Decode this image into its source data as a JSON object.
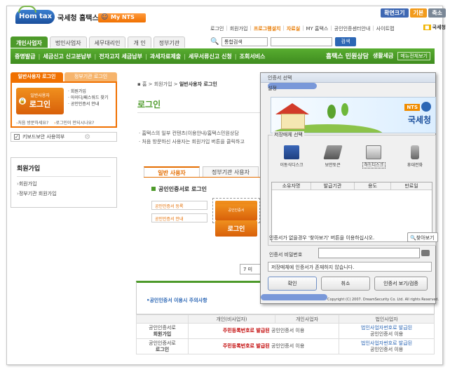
{
  "header": {
    "logo_text": "Hom tax",
    "site_name": "국세청 홈택스",
    "mynts_label": "My NTS",
    "top_buttons": [
      "확면크기",
      "기본",
      "축소"
    ],
    "top_links": [
      "로그인",
      "회원가입",
      "프로그램설치",
      "자료실",
      "MY 홈택스",
      "공인인증센터안내",
      "사이트맵"
    ],
    "kukse_label": "국세청"
  },
  "tabs": [
    "개인사업자",
    "법인사업자",
    "세무대리인",
    "개 인",
    "정부기관"
  ],
  "search": {
    "select_value": "통합검색",
    "button_label": "검색"
  },
  "green_nav": {
    "items": [
      "증명발급",
      "세금신고 신고분납부",
      "전자고지 세금납부",
      "과세자료제출",
      "세무서류신고 신청",
      "조회서비스"
    ],
    "minwon": "홈택스 민원상담",
    "life": "생활세금",
    "all_service": "메뉴전체보기"
  },
  "left": {
    "tab_general": "일반사용자 로그인",
    "tab_gov": "정부기관 로그인",
    "login_small": "일반사용자",
    "login_big": "로그인",
    "menu": [
      "· 회원가입",
      "· 아이디/패스워드 찾기",
      "· 공인인증서 안내"
    ],
    "first_visit": "처음 방문하세요?",
    "safe_login": "로그인이 안되시나요?",
    "keyboard_label": "키보드보안 사용여부",
    "join_title": "회원가입",
    "join_items": [
      "회원가입",
      "정부기관 회원가입"
    ]
  },
  "main": {
    "crumb_home": "홈",
    "crumb_mid": "회원가입",
    "crumb_cur": "일반사용자 로그인",
    "title": "로그인",
    "text1": "· 홈택스의 일부 컨텐츠(이용안내/홈택스민원상담",
    "text2": "· 처음 방문하신 사용자는 회원가입 버튼을 클릭하고",
    "tab_general": "일반 사용자",
    "tab_gov": "정부기관 사용자",
    "cert_title": "공인인증서로 로그인",
    "cert_register": "공인인증서 등록",
    "cert_guide": "공인인증서 안내",
    "cert_login_small": "공인인증서",
    "cert_login_big": "로그인",
    "pager": "7 미",
    "notice_title": "공인인증서 이용시 주의사항",
    "table_headers": [
      "",
      "개인(비사업자)",
      "개인사업자",
      "법인사업자"
    ],
    "table_rows": [
      {
        "label1": "공인인증서로",
        "label2": "회원가입",
        "c1_red": "주민등록번호로 발급된",
        "c1_rest": "공인인증서 이용",
        "c3_line1": "법인사업자번호로 발급된",
        "c3_line2": "공인인증서 이용"
      },
      {
        "label1": "공인인증서로",
        "label2": "로그인",
        "c1_red": "주민등록번호로 발급된",
        "c1_rest": "공인인증서 이용",
        "c3_line1": "법인사업자번호로 발급된",
        "c3_line2": "공인인증서 이용"
      }
    ]
  },
  "dialog": {
    "title": "인증서 선택",
    "menu": "설정",
    "nts_box": "NTS",
    "nts_name": "국세청",
    "group_label": "저장매체 선택",
    "devices": [
      "이동식디스크",
      "보안토큰",
      "하드디스크",
      "휴대전화"
    ],
    "columns": [
      "소유자명",
      "발급기관",
      "용도",
      "만료일"
    ],
    "info": "인증서가 없을경우 '찾아보기' 버튼을 이용하십시오.",
    "find_button": "찾아보기",
    "pw_label": "인증서 비밀번호",
    "status": "저장매체에 인증서가 존재하지 않습니다.",
    "ok": "확인",
    "cancel": "취소",
    "view": "인증서 보기/검증",
    "copyright": "Copyright (C) 2007. DreamSecurity Co. Ltd. All rights Reserved."
  }
}
